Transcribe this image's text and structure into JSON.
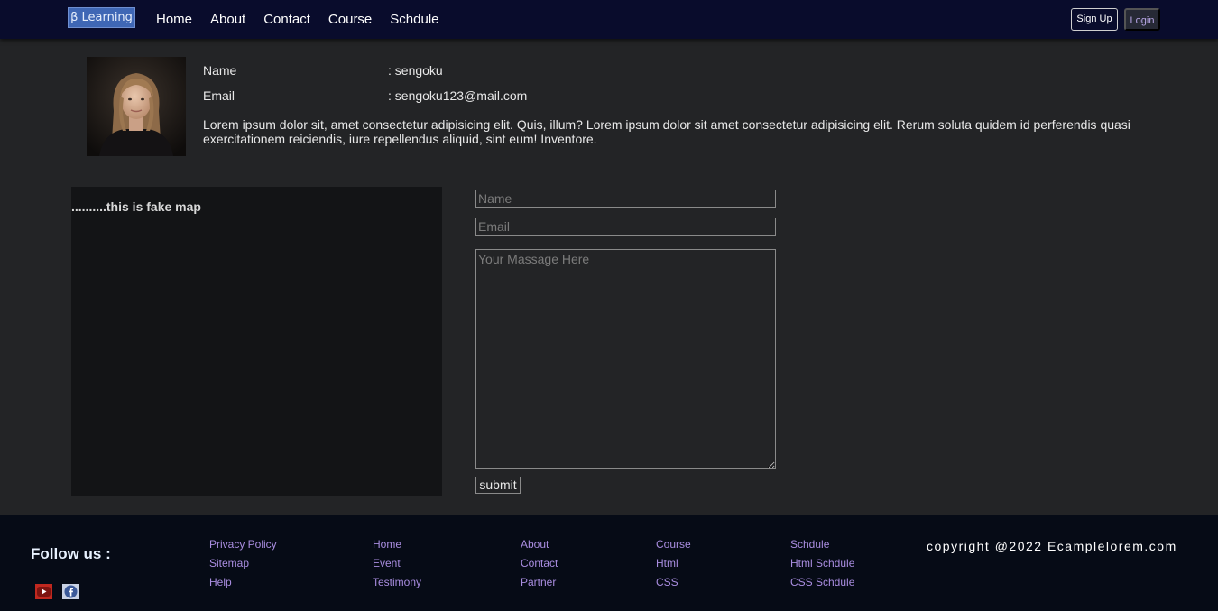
{
  "navbar": {
    "brand": "β Learning",
    "links": [
      "Home",
      "About",
      "Contact",
      "Course",
      "Schdule"
    ],
    "signup_label": "Sign Up",
    "login_label": "Login"
  },
  "profile": {
    "name_label": "Name",
    "name_value": ": sengoku",
    "email_label": "Email",
    "email_value": ": sengoku123@mail.com",
    "bio": "Lorem ipsum dolor sit, amet consectetur adipisicing elit. Quis, illum? Lorem ipsum dolor sit amet consectetur adipisicing elit. Rerum soluta quidem id perferendis quasi exercitationem reiciendis, iure repellendus aliquid, sint eum! Inventore."
  },
  "map": {
    "text": "..........this is fake map"
  },
  "form": {
    "name_placeholder": "Name",
    "email_placeholder": "Email",
    "message_placeholder": "Your Massage Here",
    "submit_label": "submit"
  },
  "footer": {
    "follow_label": "Follow us :",
    "social_icons": [
      "youtube-icon",
      "facebook-icon"
    ],
    "columns": [
      [
        "Privacy Policy",
        "Sitemap",
        "Help"
      ],
      [
        "Home",
        "Event",
        "Testimony"
      ],
      [
        "About",
        "Contact",
        "Partner"
      ],
      [
        "Course",
        "Html",
        "CSS"
      ],
      [
        "Schdule",
        "Html Schdule",
        "CSS Schdule"
      ]
    ],
    "copyright": "copyright @2022 Ecamplelorem.com"
  },
  "colors": {
    "navbar_bg": "#090c2c",
    "body_bg": "#232426",
    "footer_bg": "#060b16",
    "brand_bg": "#3f67b5",
    "footer_link": "#a98de0"
  }
}
